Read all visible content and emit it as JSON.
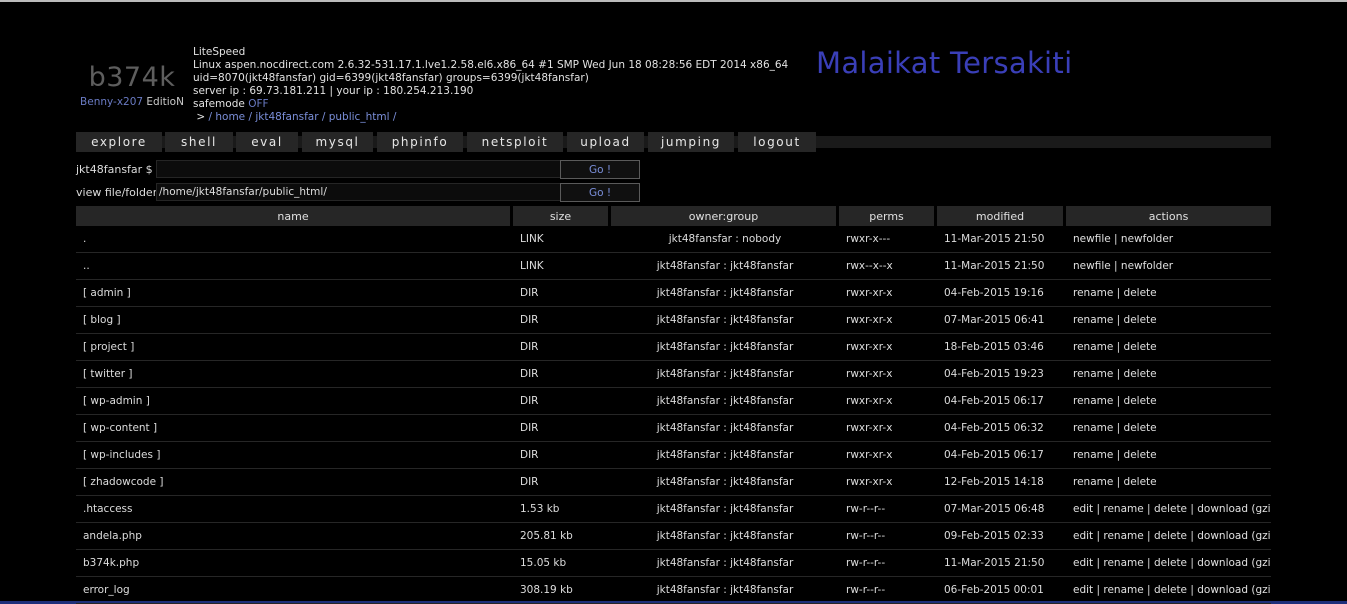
{
  "logo": {
    "name": "b374k",
    "edition_author": "Benny-x207",
    "edition_suffix": " EditioN"
  },
  "system": {
    "server_software": "LiteSpeed",
    "uname": "Linux aspen.nocdirect.com 2.6.32-531.17.1.lve1.2.58.el6.x86_64 #1 SMP Wed Jun 18 08:28:56 EDT 2014 x86_64",
    "ids": "uid=8070(jkt48fansfar) gid=6399(jkt48fansfar) groups=6399(jkt48fansfar)",
    "ips": "server ip : 69.73.181.211 | your ip : 180.254.213.190",
    "safemode_label": "safemode ",
    "safemode_value": "OFF",
    "path_prefix": " > ",
    "path_links": "/ home / jkt48fansfar / public_html /"
  },
  "banner": "Malaikat Tersakiti",
  "menu": [
    "explore",
    "shell",
    "eval",
    "mysql",
    "phpinfo",
    "netsploit",
    "upload",
    "jumping",
    "logout"
  ],
  "command": {
    "label": "jkt48fansfar $",
    "value": "",
    "button": "Go !"
  },
  "viewer": {
    "label": "view file/folder",
    "value": "/home/jkt48fansfar/public_html/",
    "button": "Go !"
  },
  "table": {
    "headers": [
      "name",
      "size",
      "owner:group",
      "perms",
      "modified",
      "actions"
    ],
    "rows": [
      {
        "name": ".",
        "size": "LINK",
        "owner": "jkt48fansfar : nobody",
        "perms": "rwxr-x---",
        "modified": "11-Mar-2015 21:50",
        "actions": [
          "newfile",
          "newfolder"
        ]
      },
      {
        "name": "..",
        "size": "LINK",
        "owner": "jkt48fansfar : jkt48fansfar",
        "perms": "rwx--x--x",
        "modified": "11-Mar-2015 21:50",
        "actions": [
          "newfile",
          "newfolder"
        ]
      },
      {
        "name": "[ admin ]",
        "size": "DIR",
        "owner": "jkt48fansfar : jkt48fansfar",
        "perms": "rwxr-xr-x",
        "modified": "04-Feb-2015 19:16",
        "actions": [
          "rename",
          "delete"
        ]
      },
      {
        "name": "[ blog ]",
        "size": "DIR",
        "owner": "jkt48fansfar : jkt48fansfar",
        "perms": "rwxr-xr-x",
        "modified": "07-Mar-2015 06:41",
        "actions": [
          "rename",
          "delete"
        ]
      },
      {
        "name": "[ project ]",
        "size": "DIR",
        "owner": "jkt48fansfar : jkt48fansfar",
        "perms": "rwxr-xr-x",
        "modified": "18-Feb-2015 03:46",
        "actions": [
          "rename",
          "delete"
        ]
      },
      {
        "name": "[ twitter ]",
        "size": "DIR",
        "owner": "jkt48fansfar : jkt48fansfar",
        "perms": "rwxr-xr-x",
        "modified": "04-Feb-2015 19:23",
        "actions": [
          "rename",
          "delete"
        ]
      },
      {
        "name": "[ wp-admin ]",
        "size": "DIR",
        "owner": "jkt48fansfar : jkt48fansfar",
        "perms": "rwxr-xr-x",
        "modified": "04-Feb-2015 06:17",
        "actions": [
          "rename",
          "delete"
        ]
      },
      {
        "name": "[ wp-content ]",
        "size": "DIR",
        "owner": "jkt48fansfar : jkt48fansfar",
        "perms": "rwxr-xr-x",
        "modified": "04-Feb-2015 06:32",
        "actions": [
          "rename",
          "delete"
        ]
      },
      {
        "name": "[ wp-includes ]",
        "size": "DIR",
        "owner": "jkt48fansfar : jkt48fansfar",
        "perms": "rwxr-xr-x",
        "modified": "04-Feb-2015 06:17",
        "actions": [
          "rename",
          "delete"
        ]
      },
      {
        "name": "[ zhadowcode ]",
        "size": "DIR",
        "owner": "jkt48fansfar : jkt48fansfar",
        "perms": "rwxr-xr-x",
        "modified": "12-Feb-2015 14:18",
        "actions": [
          "rename",
          "delete"
        ]
      },
      {
        "name": ".htaccess",
        "size": "1.53 kb",
        "owner": "jkt48fansfar : jkt48fansfar",
        "perms": "rw-r--r--",
        "modified": "07-Mar-2015 06:48",
        "actions": [
          "edit",
          "rename",
          "delete",
          "download (gzip)"
        ]
      },
      {
        "name": "andela.php",
        "size": "205.81 kb",
        "owner": "jkt48fansfar : jkt48fansfar",
        "perms": "rw-r--r--",
        "modified": "09-Feb-2015 02:33",
        "actions": [
          "edit",
          "rename",
          "delete",
          "download (gzip)"
        ]
      },
      {
        "name": "b374k.php",
        "size": "15.05 kb",
        "owner": "jkt48fansfar : jkt48fansfar",
        "perms": "rw-r--r--",
        "modified": "11-Mar-2015 21:50",
        "actions": [
          "edit",
          "rename",
          "delete",
          "download (gzip)"
        ]
      },
      {
        "name": "error_log",
        "size": "308.19 kb",
        "owner": "jkt48fansfar : jkt48fansfar",
        "perms": "rw-r--r--",
        "modified": "06-Feb-2015 00:01",
        "actions": [
          "edit",
          "rename",
          "delete",
          "download (gzip)"
        ]
      }
    ]
  }
}
